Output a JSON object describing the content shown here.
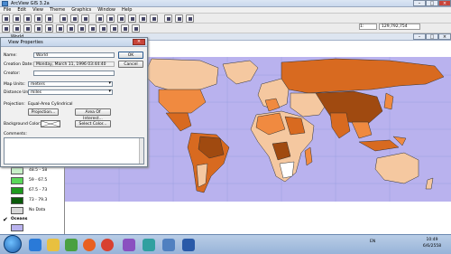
{
  "app": {
    "title": "ArcView GIS 3.2a"
  },
  "menu": [
    "File",
    "Edit",
    "View",
    "Theme",
    "Graphics",
    "Window",
    "Help"
  ],
  "toolbar": {
    "coordinate_readout": "129,792,754",
    "scale_readout": "1:"
  },
  "document": {
    "title": "World"
  },
  "dialog": {
    "title": "View Properties",
    "name_label": "Name:",
    "name_value": "World",
    "creation_date_label": "Creation Date:",
    "creation_date_value": "Monday, March 11, 1996 03:44:40",
    "creator_label": "Creator:",
    "creator_value": "",
    "map_units_label": "Map Units:",
    "map_units_value": "meters",
    "distance_units_label": "Distance Units:",
    "distance_units_value": "miles",
    "projection_label": "Projection:",
    "projection_value": "Equal-Area Cylindrical",
    "projection_button": "Projection...",
    "area_button": "Area Of Interest...",
    "bg_color_label": "Background Color:",
    "select_color_button": "Select Color...",
    "comments_label": "Comments:",
    "ok_button": "OK",
    "cancel_button": "Cancel"
  },
  "legend": {
    "items": [
      {
        "label": "48.5 - 58",
        "color": "#c8f0c8"
      },
      {
        "label": "59 - 67.5",
        "color": "#5ad85a"
      },
      {
        "label": "67.5 - 73",
        "color": "#1e9a1e"
      },
      {
        "label": "73 - 79.3",
        "color": "#0a5a0a"
      },
      {
        "label": "No Data",
        "color": "#d8d8d8"
      }
    ],
    "oceans_label": "Oceans",
    "oceans_color": "#b9b2ee"
  },
  "taskbar": {
    "lang": "EN",
    "time": "10:49",
    "date": "6/6/2558"
  }
}
